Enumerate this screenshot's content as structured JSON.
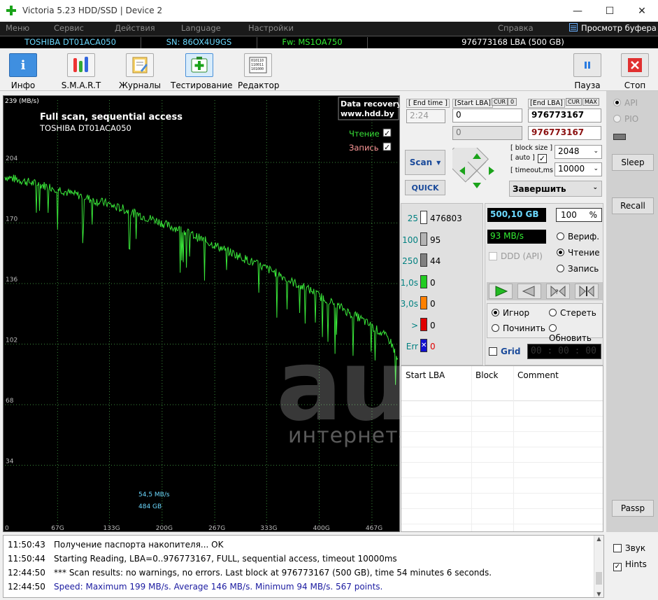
{
  "window": {
    "title": "Victoria 5.23 HDD/SSD | Device 2",
    "minimize": "—",
    "maximize": "☐",
    "close": "✕"
  },
  "menu": {
    "items": [
      "Меню",
      "Сервис",
      "Действия",
      "Language",
      "Настройки"
    ],
    "help": "Справка",
    "buffer": "Просмотр буфера"
  },
  "drive": {
    "model": "TOSHIBA DT01ACA050",
    "serial": "SN: 86OX4U9GS",
    "firmware": "Fw: MS1OA750",
    "capacity": "976773168 LBA (500 GB)"
  },
  "toolbar": {
    "left": [
      {
        "label": "Инфо",
        "icon": "info-icon"
      },
      {
        "label": "S.M.A.R.T",
        "icon": "smart-icon"
      },
      {
        "label": "Журналы",
        "icon": "logs-icon"
      },
      {
        "label": "Тестирование",
        "icon": "testing-icon"
      },
      {
        "label": "Редактор",
        "icon": "editor-icon"
      }
    ],
    "pause": "Пауза",
    "stop": "Стоп"
  },
  "chart_data": {
    "type": "line",
    "title": "Full scan, sequential access",
    "subtitle": "TOSHIBA DT01ACA050",
    "y_unit": "239 (MB/s)",
    "ylim": [
      0,
      239
    ],
    "y_ticks": [
      "204",
      "170",
      "136",
      "102",
      "68",
      "34"
    ],
    "x_ticks": [
      "0",
      "67G",
      "133G",
      "200G",
      "267G",
      "333G",
      "400G",
      "467G"
    ],
    "xlim": [
      0,
      500
    ],
    "series": [
      {
        "name": "Чтение",
        "color": "#39e639",
        "x": [
          0,
          10,
          20,
          30,
          40,
          50,
          60,
          70,
          80,
          90,
          100,
          110,
          120,
          130,
          140,
          150,
          160,
          170,
          180,
          190,
          200,
          210,
          220,
          230,
          240,
          250,
          260,
          270,
          280,
          290,
          300,
          310,
          320,
          330,
          340,
          350,
          360,
          370,
          380,
          390,
          400,
          410,
          420,
          430,
          440,
          450,
          460,
          470,
          480,
          490,
          500
        ],
        "y": [
          196,
          195,
          194,
          193,
          192,
          191,
          190,
          189,
          187,
          186,
          185,
          183,
          182,
          181,
          179,
          178,
          176,
          175,
          173,
          172,
          170,
          168,
          167,
          165,
          163,
          161,
          159,
          157,
          155,
          153,
          151,
          149,
          147,
          145,
          143,
          141,
          138,
          136,
          134,
          132,
          129,
          127,
          124,
          122,
          119,
          117,
          114,
          111,
          108,
          104,
          94
        ]
      }
    ],
    "legend": [
      {
        "label": "Чтение",
        "checked": true,
        "color": "#39e639"
      },
      {
        "label": "Запись",
        "checked": true,
        "color": "#ff9999"
      }
    ],
    "badge": [
      "Data recovery",
      "www.hdd.by"
    ],
    "current": {
      "speed": "54,5 MB/s",
      "position": "484 GB"
    }
  },
  "scan": {
    "end_time_label": "[ End time ]",
    "end_time": "2:24",
    "start_lba_label": "[Start LBA]",
    "end_lba_label": "[End LBA]",
    "cur": "CUR",
    "zero": "0",
    "max": "MAX",
    "start_lba": "0",
    "start_lba_cur": "0",
    "end_lba": "976773167",
    "end_lba_cur": "976773167",
    "scan_button": "Scan",
    "quick_button": "QUICK",
    "block_size_label": "[ block size ]",
    "auto_label": "[ auto ]",
    "timeout_label": "[ timeout,ms ]",
    "block_size": "2048",
    "timeout": "10000",
    "finish": "Завершить"
  },
  "blocks": [
    {
      "label": "25",
      "count": "476803",
      "color": "#ffffff",
      "labelColor": "#008080"
    },
    {
      "label": "100",
      "count": "95",
      "color": "#b4b4b4",
      "labelColor": "#008080"
    },
    {
      "label": "250",
      "count": "44",
      "color": "#808080",
      "labelColor": "#008080"
    },
    {
      "label": "1,0s",
      "count": "0",
      "color": "#22cc22",
      "labelColor": "#008080"
    },
    {
      "label": "3,0s",
      "count": "0",
      "color": "#ff8000",
      "labelColor": "#008080"
    },
    {
      "label": ">",
      "count": "0",
      "color": "#e00000",
      "labelColor": "#008080"
    },
    {
      "label": "Err",
      "count": "0",
      "color": "#1010d0",
      "labelColor": "#008080"
    }
  ],
  "status": {
    "gb": "500,10 GB",
    "percent": "100",
    "percent_sign": "%",
    "speed": "93 MB/s",
    "ddd": "DDD (API)",
    "verify": "Вериф.",
    "read": "Чтение",
    "write": "Запись",
    "ignore": "Игнор",
    "erase": "Стереть",
    "repair": "Починить",
    "refresh": "Обновить",
    "grid": "Grid",
    "timer": "00 : 00 : 00"
  },
  "table": {
    "columns": [
      "Start LBA",
      "Block",
      "Comment"
    ]
  },
  "sidebar": {
    "api": "API",
    "pio": "PIO",
    "sleep": "Sleep",
    "recall": "Recall",
    "passp": "Passp"
  },
  "log": [
    {
      "time": "11:50:43",
      "text": "Получение паспорта накопителя... OK",
      "color": "#000000"
    },
    {
      "time": "11:50:44",
      "text": "Starting Reading, LBA=0..976773167, FULL, sequential access, timeout 10000ms",
      "color": "#000000"
    },
    {
      "time": "12:44:50",
      "text": "*** Scan results: no warnings, no errors. Last block at 976773167 (500 GB), time 54 minutes 6 seconds.",
      "color": "#000000"
    },
    {
      "time": "12:44:50",
      "text": "Speed: Maximum 199 MB/s. Average 146 MB/s. Minimum 94 MB/s. 567 points.",
      "color": "#1a1aa0"
    }
  ],
  "options": {
    "sound": "Звук",
    "hints": "Hints"
  },
  "watermark": {
    "logo": "au",
    "tagline": "интернет-аукцион"
  }
}
